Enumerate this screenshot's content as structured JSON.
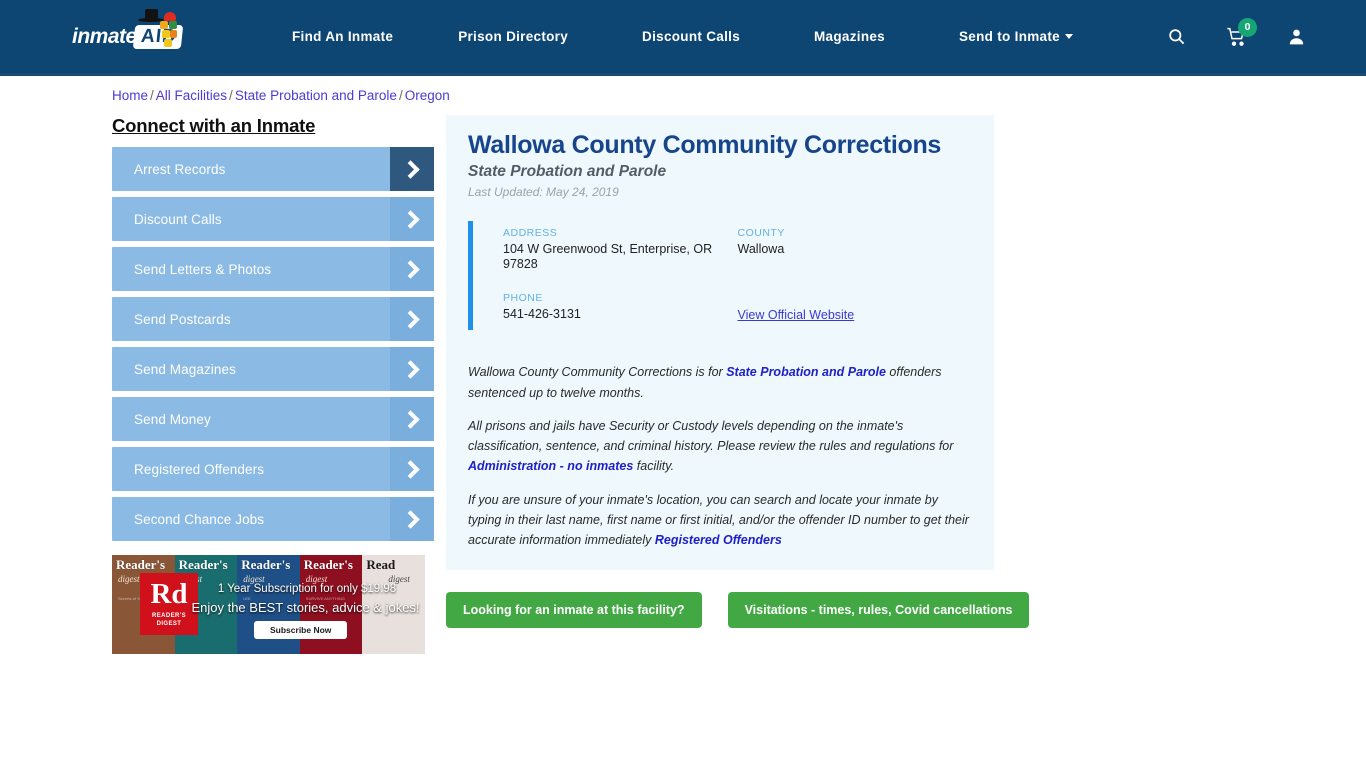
{
  "header": {
    "logo": {
      "word": "inmate",
      "aid": "AID"
    },
    "nav": [
      {
        "label": "Find An Inmate",
        "icon": null
      },
      {
        "label": "Prison Directory",
        "icon": null
      },
      {
        "label": "Discount Calls",
        "icon": null
      },
      {
        "label": "Magazines",
        "icon": null
      },
      {
        "label": "Send to Inmate",
        "icon": "chevron-down-icon"
      }
    ],
    "icons": {
      "search": "search-icon",
      "cart": "shopping-cart-icon",
      "cart_count": "0",
      "account": "user-account-icon"
    },
    "colors": {
      "bar": "#0d4573",
      "badge": "#17a673"
    }
  },
  "breadcrumb": {
    "items": [
      "Home",
      "All Facilities",
      "State Probation and Parole",
      "Oregon"
    ],
    "separator": "/"
  },
  "sidebar": {
    "title": "Connect with an Inmate",
    "items": [
      {
        "label": "Arrest Records",
        "active": true
      },
      {
        "label": "Discount Calls",
        "active": false
      },
      {
        "label": "Send Letters & Photos",
        "active": false
      },
      {
        "label": "Send Postcards",
        "active": false
      },
      {
        "label": "Send Magazines",
        "active": false
      },
      {
        "label": "Send Money",
        "active": false
      },
      {
        "label": "Registered Offenders",
        "active": false
      },
      {
        "label": "Second Chance Jobs",
        "active": false
      }
    ]
  },
  "ad": {
    "brand": "Rd",
    "brand_sub": "READER'S\nDIGEST",
    "line1": "1 Year Subscription for only $19.98",
    "line2": "Enjoy the BEST stories, advice & jokes!",
    "button": "Subscribe Now",
    "covers": [
      {
        "title": "Reader's",
        "sub": "digest",
        "tagline": "Secrets of Your Mind",
        "bg": "#8a5638"
      },
      {
        "title": "Reader's",
        "sub": "digest",
        "tagline": "",
        "bg": "#1a6d6e"
      },
      {
        "title": "Reader's",
        "sub": "digest",
        "tagline": "LEE",
        "bg": "#1e4f86"
      },
      {
        "title": "Reader's",
        "sub": "digest",
        "tagline": "SURVIVE ANYTHING",
        "bg": "#8e1020"
      },
      {
        "title": "Read",
        "sub": "digest",
        "tagline": "",
        "bg": "#e8e0dc"
      }
    ]
  },
  "facility": {
    "name": "Wallowa County Community Corrections",
    "type": "State Probation and Parole",
    "last_updated": "Last Updated: May 24, 2019",
    "info": {
      "address_label": "ADDRESS",
      "address_value": "104 W Greenwood St, Enterprise, OR 97828",
      "phone_label": "PHONE",
      "phone_value": "541-426-3131",
      "county_label": "COUNTY",
      "county_value": "Wallowa",
      "website_link": "View Official Website"
    },
    "paragraphs": {
      "p1_a": "Wallowa County Community Corrections is for ",
      "p1_link": "State Probation and Parole",
      "p1_b": " offenders sentenced up to twelve months.",
      "p2_a": "All prisons and jails have Security or Custody levels depending on the inmate's classification, sentence, and criminal history. Please review the rules and regulations for ",
      "p2_link": "Administration - no inmates",
      "p2_b": " facility.",
      "p3_a": "If you are unsure of your inmate's location, you can search and locate your inmate by typing in their last name, first name or first initial, and/or the offender ID number to get their accurate information immediately ",
      "p3_link": "Registered Offenders"
    },
    "buttons": [
      "Looking for an inmate at this facility?",
      "Visitations - times, rules, Covid cancellations"
    ]
  },
  "colors": {
    "accent_blue": "#1e90e8",
    "panel_bg": "#eef8fd",
    "title_blue": "#17458c",
    "green_button": "#42a843",
    "sidebar_item": "#8bbbe4"
  }
}
